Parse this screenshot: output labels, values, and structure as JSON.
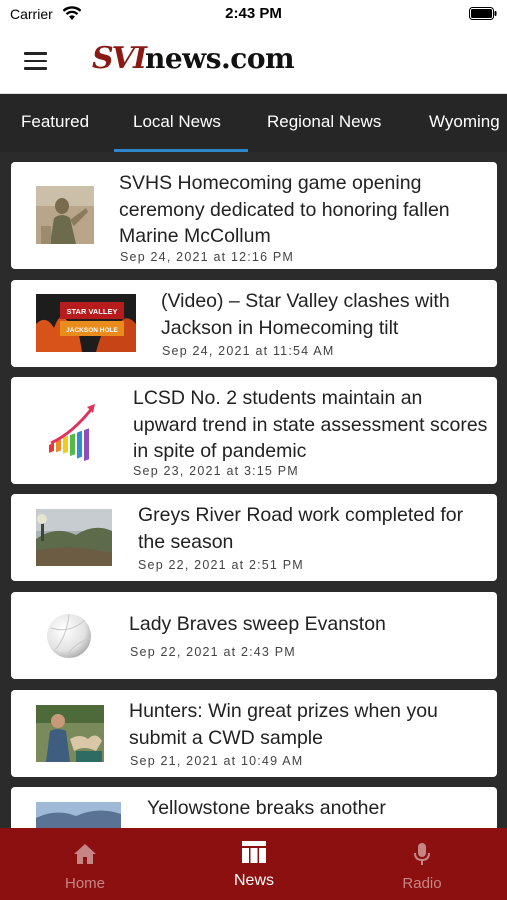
{
  "status": {
    "carrier": "Carrier",
    "time": "2:43 PM"
  },
  "header": {
    "logo_part1": "SVI",
    "logo_part2": "news.com"
  },
  "tabs": [
    {
      "label": "Featured"
    },
    {
      "label": "Local News",
      "active": true
    },
    {
      "label": "Regional News"
    },
    {
      "label": "Wyoming"
    }
  ],
  "articles": [
    {
      "title": "SVHS Homecoming game opening ceremony dedicated to honoring fallen Marine McCollum",
      "date": "Sep 24, 2021 at 12:16 PM"
    },
    {
      "title": "(Video) – Star Valley clashes with Jackson in Homecoming tilt",
      "date": "Sep 24, 2021 at 11:54 AM",
      "thumb_text_1": "STAR VALLEY",
      "thumb_text_2": "JACKSON HOLE"
    },
    {
      "title": "LCSD No. 2 students maintain an upward trend in state assessment scores in spite of pandemic",
      "date": "Sep 23, 2021 at 3:15 PM"
    },
    {
      "title": "Greys River Road work completed for the season",
      "date": "Sep 22, 2021 at 2:51 PM"
    },
    {
      "title": "Lady Braves sweep Evanston",
      "date": "Sep 22, 2021 at 2:43 PM"
    },
    {
      "title": "Hunters: Win great prizes when you submit a CWD sample",
      "date": "Sep 21, 2021 at 10:49 AM"
    },
    {
      "title": "Yellowstone breaks another",
      "date": ""
    }
  ],
  "nav": {
    "home": "Home",
    "news": "News",
    "radio": "Radio"
  },
  "colors": {
    "brand_red": "#8c1010",
    "tab_underline": "#2d86c9",
    "tab_bar": "#262626"
  }
}
